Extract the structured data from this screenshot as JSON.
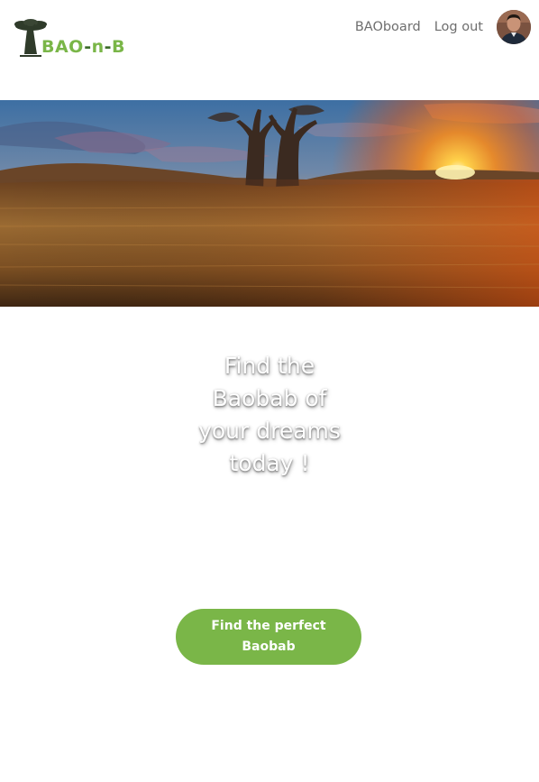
{
  "brand": {
    "logo_text_part1": "BAO",
    "logo_text_dash1": "-",
    "logo_text_part2": "n",
    "logo_text_dash2": "-",
    "logo_text_part3": "B",
    "logo_icon": "baobab-tree-icon",
    "primary_color": "#7ab648",
    "dark_green": "#3c6b2a"
  },
  "nav": {
    "links": [
      {
        "label": "BAOboard"
      },
      {
        "label": "Log out"
      }
    ],
    "avatar_icon": "user-avatar"
  },
  "hero": {
    "image": "savanna-sunset-baobab"
  },
  "main": {
    "tagline_line1": "Find the",
    "tagline_line2": "Baobab of",
    "tagline_line3": "your dreams",
    "tagline_line4": "today !",
    "cta_label": "Find the perfect Baobab"
  }
}
